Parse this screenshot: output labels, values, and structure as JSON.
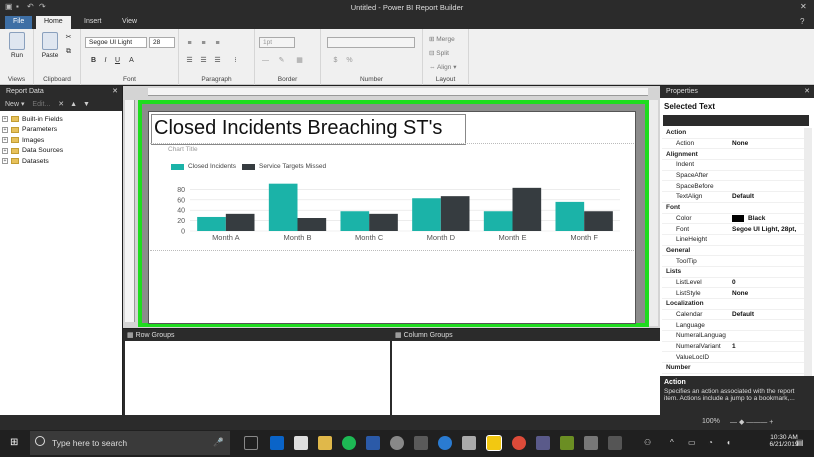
{
  "window": {
    "title": "Untitled - Power BI Report Builder"
  },
  "ribbon_tabs": [
    {
      "label": "File"
    },
    {
      "label": "Home"
    },
    {
      "label": "Insert"
    },
    {
      "label": "View"
    }
  ],
  "ribbon": {
    "run_label": "Run",
    "paste_label": "Paste",
    "font_name": "Segoe UI Light",
    "font_size": "28",
    "border_width": "1pt",
    "merge_label": "Merge",
    "split_label": "Split",
    "align_label": "Align",
    "groups": [
      "Views",
      "Clipboard",
      "Font",
      "Paragraph",
      "Border",
      "Number",
      "Layout"
    ]
  },
  "report_data": {
    "title": "Report Data",
    "new_label": "New",
    "edit_label": "Edit...",
    "items": [
      "Built-in Fields",
      "Parameters",
      "Images",
      "Data Sources",
      "Datasets"
    ]
  },
  "report": {
    "title": "Closed Incidents Breaching ST's",
    "chart_title_placeholder": "Chart Title"
  },
  "chart_data": {
    "type": "bar",
    "categories": [
      "Month A",
      "Month B",
      "Month C",
      "Month D",
      "Month E",
      "Month F"
    ],
    "series": [
      {
        "name": "Closed Incidents",
        "color": "#1bb3a8",
        "values": [
          27,
          91,
          38,
          63,
          38,
          56
        ]
      },
      {
        "name": "Service Targets Missed",
        "color": "#363c40",
        "values": [
          33,
          25,
          33,
          67,
          83,
          38
        ]
      }
    ],
    "y_ticks": [
      "0",
      "20",
      "40",
      "60",
      "80"
    ],
    "ylim": [
      0,
      100
    ],
    "legend": "top-left",
    "grid": true
  },
  "groups": {
    "row_label": "Row Groups",
    "column_label": "Column Groups"
  },
  "properties": {
    "title": "Properties",
    "selected": "Selected Text",
    "rows": [
      {
        "cat": true,
        "name": "Action"
      },
      {
        "name": "Action",
        "value": "None"
      },
      {
        "cat": true,
        "name": "Alignment"
      },
      {
        "name": "Indent",
        "value": ""
      },
      {
        "name": "SpaceAfter",
        "value": ""
      },
      {
        "name": "SpaceBefore",
        "value": ""
      },
      {
        "name": "TextAlign",
        "value": "Default"
      },
      {
        "cat": true,
        "name": "Font"
      },
      {
        "name": "Color",
        "value": "Black",
        "swatch": "#000000"
      },
      {
        "name": "Font",
        "value": "Segoe UI Light, 28pt,"
      },
      {
        "name": "LineHeight",
        "value": ""
      },
      {
        "cat": true,
        "name": "General"
      },
      {
        "name": "ToolTip",
        "value": ""
      },
      {
        "cat": true,
        "name": "Lists"
      },
      {
        "name": "ListLevel",
        "value": "0"
      },
      {
        "name": "ListStyle",
        "value": "None"
      },
      {
        "cat": true,
        "name": "Localization"
      },
      {
        "name": "Calendar",
        "value": "Default"
      },
      {
        "name": "Language",
        "value": ""
      },
      {
        "name": "NumeralLanguag",
        "value": ""
      },
      {
        "name": "NumeralVariant",
        "value": "1"
      },
      {
        "name": "ValueLocID",
        "value": ""
      },
      {
        "cat": true,
        "name": "Number"
      }
    ],
    "desc_title": "Action",
    "desc_text": "Specifies an action associated with the report item. Actions include a jump to a bookmark,..."
  },
  "status": {
    "zoom": "100%"
  },
  "taskbar": {
    "search_placeholder": "Type here to search",
    "time": "10:30 AM",
    "date": "6/21/2019"
  }
}
